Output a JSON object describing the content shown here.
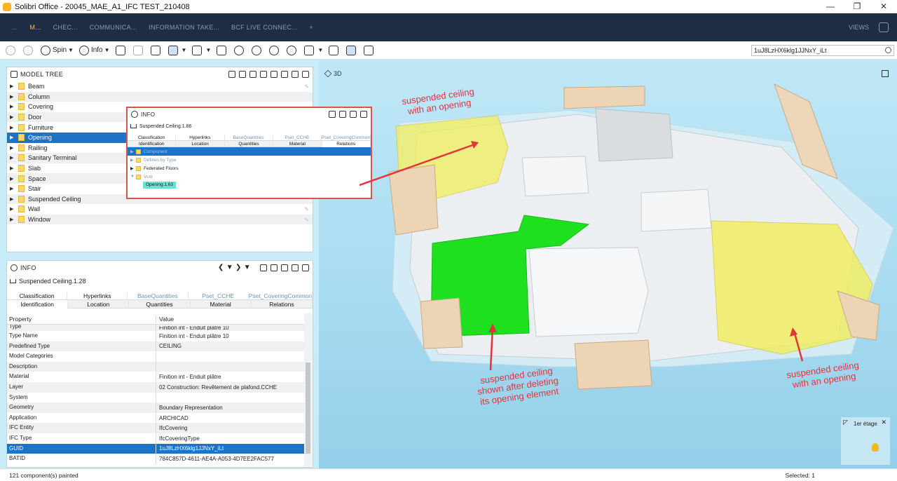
{
  "window": {
    "title": "Solibri Office - 20045_MAE_A1_IFC TEST_210408",
    "controls": [
      "—",
      "❐",
      "✕"
    ]
  },
  "menubar": {
    "tabs": [
      "...",
      "M...",
      "CHEC...",
      "COMMUNICA...",
      "INFORMATION TAKE...",
      "BCF LIVE CONNEC...",
      "+"
    ],
    "views_label": "VIEWS"
  },
  "toolbar": {
    "spin_label": "Spin",
    "info_label": "Info",
    "search_value": "1uJ8LzHX6klg1JJNxY_iLt"
  },
  "model_tree": {
    "title": "MODEL TREE",
    "items": [
      {
        "label": "Beam"
      },
      {
        "label": "Column"
      },
      {
        "label": "Covering"
      },
      {
        "label": "Door"
      },
      {
        "label": "Furniture"
      },
      {
        "label": "Opening"
      },
      {
        "label": "Railing"
      },
      {
        "label": "Sanitary Terminal"
      },
      {
        "label": "Slab"
      },
      {
        "label": "Space"
      },
      {
        "label": "Stair"
      },
      {
        "label": "Suspended Ceiling"
      },
      {
        "label": "Wall"
      },
      {
        "label": "Window"
      }
    ],
    "selected_index": 5
  },
  "info": {
    "title": "INFO",
    "subject": "Suspended Ceiling.1.28",
    "tabs_top": [
      "Classification",
      "Hyperlinks",
      "BaseQuantities",
      "Pset_CCHE",
      "Pset_CoveringCommon"
    ],
    "tabs_bottom": [
      "Identification",
      "Location",
      "Quantities",
      "Material",
      "Relations"
    ],
    "active_tab": "Identification",
    "columns": [
      "Property",
      "Value"
    ],
    "rows": [
      {
        "property": "Type",
        "value": "Finition int - Enduit plâtre 10"
      },
      {
        "property": "Type Name",
        "value": "Finition int - Enduit plâtre 10"
      },
      {
        "property": "Predefined Type",
        "value": "CEILING"
      },
      {
        "property": "Model Categories",
        "value": ""
      },
      {
        "property": "Description",
        "value": ""
      },
      {
        "property": "Material",
        "value": "Finition int - Enduit plâtre"
      },
      {
        "property": "Layer",
        "value": "02 Construction: Revêtement de plafond.CCHE"
      },
      {
        "property": "System",
        "value": ""
      },
      {
        "property": "Geometry",
        "value": "Boundary Representation"
      },
      {
        "property": "Application",
        "value": "ARCHICAD"
      },
      {
        "property": "IFC Entity",
        "value": "IfcCovering"
      },
      {
        "property": "IFC Type",
        "value": "IfcCoveringType"
      },
      {
        "property": "GUID",
        "value": "1uJ8LzHX6klg1JJNxY_iLt"
      },
      {
        "property": "BATID",
        "value": "784C857D-4611-AE4A-A053-4D7EE2FAC577"
      }
    ],
    "selected_row": 12
  },
  "popup": {
    "title": "INFO",
    "subject": "Suspended Ceiling.1.86",
    "tabs_top": [
      "Classification",
      "Hyperlinks",
      "BaseQuantities",
      "Pset_CCHE",
      "Pset_CoveringCommon"
    ],
    "tabs_bottom": [
      "Identification",
      "Location",
      "Quantities",
      "Material",
      "Relations"
    ],
    "active_tab": "Relations",
    "rows": [
      {
        "label": "Component",
        "state": "selected"
      },
      {
        "label": "Defines by Type",
        "state": "muted"
      },
      {
        "label": "Federated Floors",
        "state": "normal"
      },
      {
        "label": "Void",
        "state": "muted"
      }
    ],
    "child": "Opening.1.63"
  },
  "viewport": {
    "title": "3D",
    "annotations": [
      "suspended ceiling\nwith an opening",
      "suspended ceiling\nshown after deleting\nits opening element",
      "suspended ceiling\nwith an opening"
    ],
    "floor_label": "1er étage"
  },
  "status": {
    "left": "121 component(s) painted",
    "right": "Selected: 1"
  },
  "colors": {
    "menubar": "#1f2d44",
    "accent": "#f0c419",
    "selection": "#1b74c8",
    "annotation": "#e4343a",
    "highlight_green": "#1ee01e",
    "ceiling_yellow": "#f1ee5c"
  }
}
